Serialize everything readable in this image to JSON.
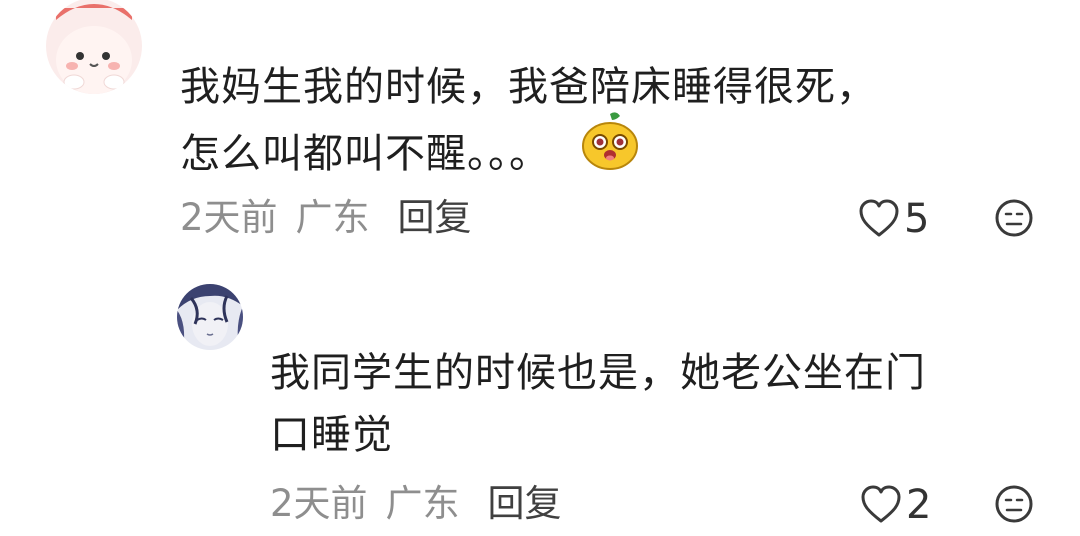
{
  "comments": [
    {
      "text_line1": "我妈生我的时候，我爸陪床睡得很死，",
      "text_line2": "怎么叫都叫不醒。。。",
      "emoji": "grinning-mascot-emoji",
      "time": "2天前",
      "location": "广东",
      "reply_label": "回复",
      "likes": "5",
      "avatar": "pink-bunny-avatar"
    },
    {
      "text_line1": "我同学生的时候也是，她老公坐在门",
      "text_line2": "口睡觉",
      "time": "2天前",
      "location": "广东",
      "reply_label": "回复",
      "likes": "2",
      "avatar": "sketch-portrait-avatar"
    }
  ],
  "colors": {
    "meta_text": "#8e8e8e",
    "reply_text": "#404040",
    "body_text": "#1f1f1f"
  },
  "icons": [
    "heart-outline-icon",
    "neutral-face-icon"
  ]
}
